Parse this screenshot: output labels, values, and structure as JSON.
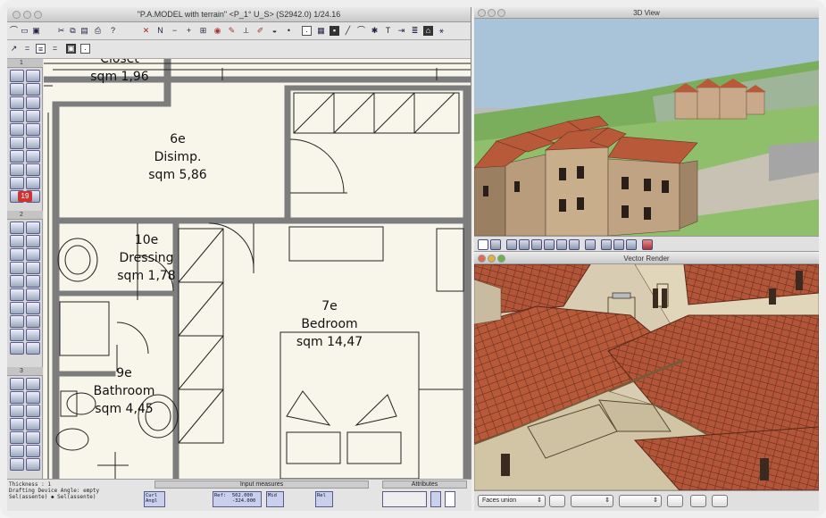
{
  "cad_window": {
    "title": "\"P.A.MODEL with terrain\" <P_1° U_S> (S2942.0) 1/24.16"
  },
  "toolbar1_icons": [
    "menu-icon",
    "open-icon",
    "save-icon",
    "cut-icon",
    "copy-icon",
    "paste-icon",
    "print-icon",
    "help-icon",
    "cross-icon",
    "n-icon",
    "minus-icon",
    "plus-icon",
    "grid-icon",
    "camera-icon",
    "paint-icon",
    "ruler-icon",
    "pencil-icon",
    "dot-icon",
    "point-icon",
    "fill-icon",
    "edit-icon",
    "line-icon",
    "arc-icon",
    "snap-icon",
    "text-icon",
    "dimension-icon",
    "layer-icon",
    "magnet-icon"
  ],
  "palette": {
    "section1": "1",
    "section2": "2",
    "section3": "3",
    "badge_value": "19"
  },
  "plan": {
    "rooms": [
      {
        "id": "closet",
        "code": "",
        "name": "Closet",
        "area": "sqm 1,96"
      },
      {
        "id": "disimp",
        "code": "6e",
        "name": "Disimp.",
        "area": "sqm 5,86"
      },
      {
        "id": "dressing",
        "code": "10e",
        "name": "Dressing",
        "area": "sqm 1,78"
      },
      {
        "id": "bedroom",
        "code": "7e",
        "name": "Bedroom",
        "area": "sqm 14,47"
      },
      {
        "id": "bathroom",
        "code": "9e",
        "name": "Bathroom",
        "area": "sqm 4,45"
      }
    ]
  },
  "statusbar": {
    "lines": [
      "Thickness          : 1",
      "Drafting Device Angle: empty",
      "Sel(assente) ◆ Sel(assente)"
    ],
    "input_measures_label": "Input measures",
    "attributes_label": "Attributes",
    "field_left": "Curl\nAngl",
    "field_ref": "Ref:  502.000\n      -324.000",
    "field_mid": "Mid",
    "field_right": "Rel"
  },
  "view3d": {
    "title": "3D View"
  },
  "vector_render": {
    "title": "Vector Render"
  },
  "render_toolbar": {
    "faces_dropdown": "Faces union"
  },
  "colors": {
    "roof": "#b8593a",
    "sky": "#a9c3d9",
    "grass": "#7bae5c",
    "plan_bg": "#f8f6ea",
    "wall": "#7d7d7d"
  }
}
